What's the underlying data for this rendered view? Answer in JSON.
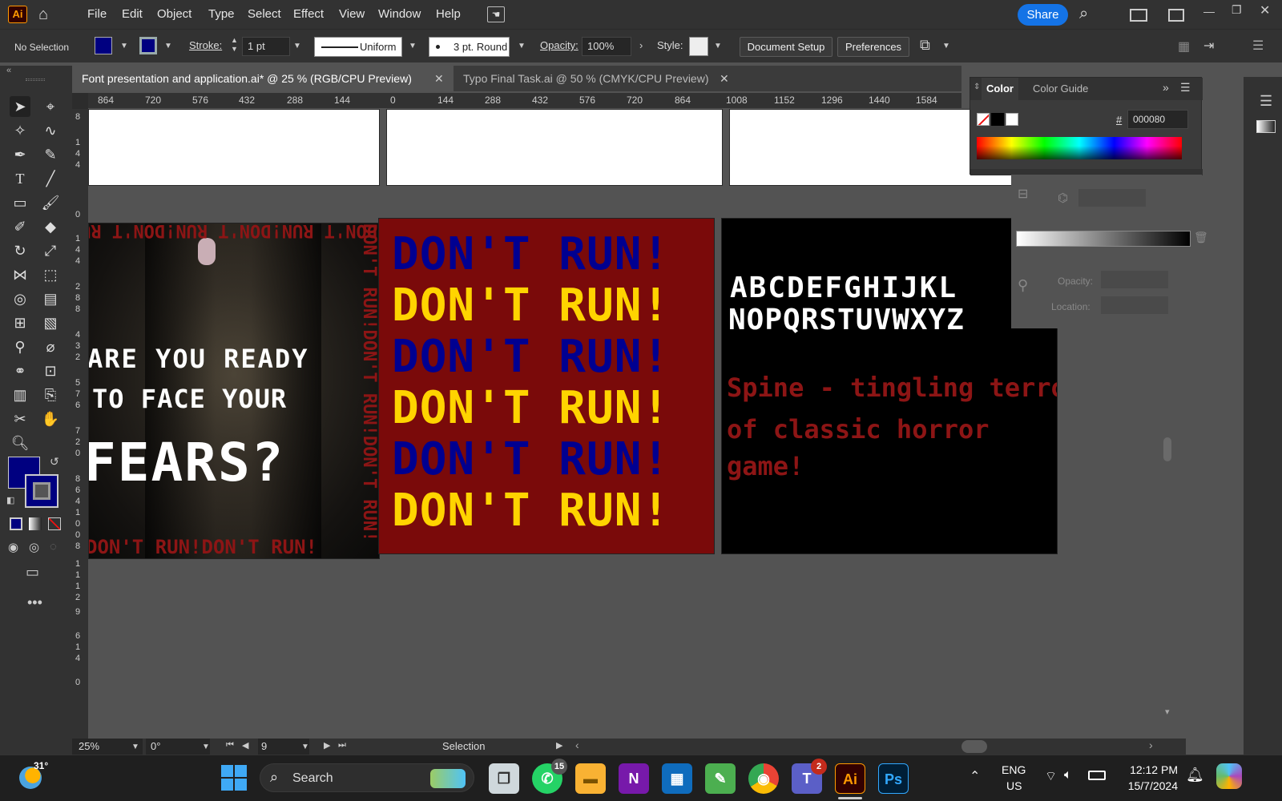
{
  "app": {
    "logo": "Ai",
    "home_icon": "home-icon"
  },
  "menu": [
    "File",
    "Edit",
    "Object",
    "Type",
    "Select",
    "Effect",
    "View",
    "Window",
    "Help"
  ],
  "header_right": {
    "share": "Share"
  },
  "control": {
    "selection": "No Selection",
    "fill_color": "#000080",
    "stroke_label": "Stroke:",
    "stroke_weight": "1 pt",
    "stroke_profile": "Uniform",
    "brush": "3 pt. Round",
    "opacity_label": "Opacity:",
    "opacity": "100%",
    "style_label": "Style:",
    "document_setup": "Document Setup",
    "preferences": "Preferences"
  },
  "tabs": [
    {
      "label": "Font presentation and application.ai* @ 25 % (RGB/CPU Preview)",
      "active": true
    },
    {
      "label": "Typo Final Task.ai @ 50 % (CMYK/CPU Preview)",
      "active": false
    }
  ],
  "ruler": {
    "h": [
      "864",
      "720",
      "576",
      "432",
      "288",
      "144",
      "0",
      "144",
      "288",
      "432",
      "576",
      "720",
      "864",
      "1008",
      "1152",
      "1296",
      "1440",
      "1584"
    ],
    "v": [
      "8",
      "1",
      "4",
      "4",
      "0",
      "1",
      "4",
      "4",
      "2",
      "8",
      "8",
      "4",
      "3",
      "2",
      "5",
      "7",
      "6",
      "7",
      "2",
      "0",
      "8",
      "6",
      "4",
      "1",
      "0",
      "0",
      "8",
      "1",
      "1",
      "1",
      "2",
      "9",
      "6",
      "1",
      "4",
      "0"
    ]
  },
  "artboards": {
    "poster1": {
      "line1": "ARE YOU READY",
      "line2": "TO FACE YOUR",
      "line3": "FEARS?",
      "top_strip": "DON'T RUN!DON'T RUN!DON'T RUN!",
      "side_strip": "DON'T RUN!DON'T RUN!DON'T RUN!",
      "bottom_strip": "DON'T RUN!DON'T RUN!"
    },
    "poster2": {
      "lines": [
        "DON'T RUN!",
        "DON'T RUN!",
        "DON'T RUN!",
        "DON'T RUN!",
        "DON'T RUN!",
        "DON'T RUN!"
      ],
      "colors": [
        "#000090",
        "#ffd400",
        "#000090",
        "#ffd400",
        "#000090",
        "#ffd400"
      ],
      "background": "#7a0a0a"
    },
    "poster3": {
      "alpha1": "ABCDEFGHIJKL",
      "alpha2": "NOPQRSTUVWXYZ",
      "tag1": "Spine - tingling terror",
      "tag2": "of classic horror",
      "tag3": "game!"
    }
  },
  "color_panel": {
    "tab_active": "Color",
    "tab_other": "Color Guide",
    "hex_label": "#",
    "hex": "000080"
  },
  "gradient_panel": {
    "opacity_label": "Opacity:",
    "location_label": "Location:"
  },
  "status": {
    "zoom": "25%",
    "rotation": "0°",
    "artboard": "9",
    "tool": "Selection"
  },
  "taskbar": {
    "weather": "31°",
    "search": "Search",
    "whatsapp_badge": "15",
    "teams_badge": "2",
    "lang1": "ENG",
    "lang2": "US",
    "time": "12:12 PM",
    "date": "15/7/2024"
  }
}
